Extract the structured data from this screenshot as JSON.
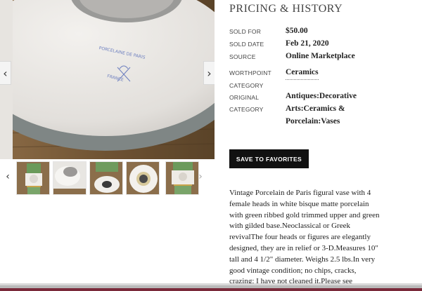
{
  "gallery": {
    "prev_arrow": "‹",
    "next_arrow": "›",
    "thumb_prev": "‹",
    "thumb_next": "›",
    "main_image_stamp": [
      "PORCELAINE DE PARIS",
      "FRANCE"
    ],
    "thumbnails": [
      "figural-vase-front",
      "vase-top-view",
      "vase-rim-view",
      "vase-base-view",
      "figural-vase-side"
    ]
  },
  "pricing": {
    "title": "PRICING & HISTORY",
    "sold_for_label": "SOLD FOR",
    "sold_for_value": "$50.00",
    "sold_date_label": "SOLD DATE",
    "sold_date_value": "Feb 21, 2020",
    "source_label": "SOURCE",
    "source_value": "Online Marketplace",
    "worthpoint_label_1": "WORTHPOINT",
    "worthpoint_label_2": "CATEGORY",
    "worthpoint_value": "Ceramics",
    "original_label_1": "ORIGINAL",
    "original_label_2": "CATEGORY",
    "original_value_1": "Antiques:Decorative",
    "original_value_2": "Arts:Ceramics &",
    "original_value_3": "Porcelain:Vases"
  },
  "actions": {
    "save_label": "SAVE TO FAVORITES"
  },
  "description": "Vintage Porcelain de Paris figural vase with 4 female heads in white bisque matte porcelain with green ribbed gold trimmed upper and green with gilded base.Neoclassical or Greek revivalThe four heads or figures are elegantly designed, they are in relief or 3-D.Measures 10\" tall and 4 1/2\" diameter. Weighs 2.5 lbs.In very good vintage condition; no chips, cracks, crazing; I have not cleaned it.Please see",
  "colors": {
    "button_bg": "#111111",
    "bottom_accent": "#7a2a3a"
  }
}
